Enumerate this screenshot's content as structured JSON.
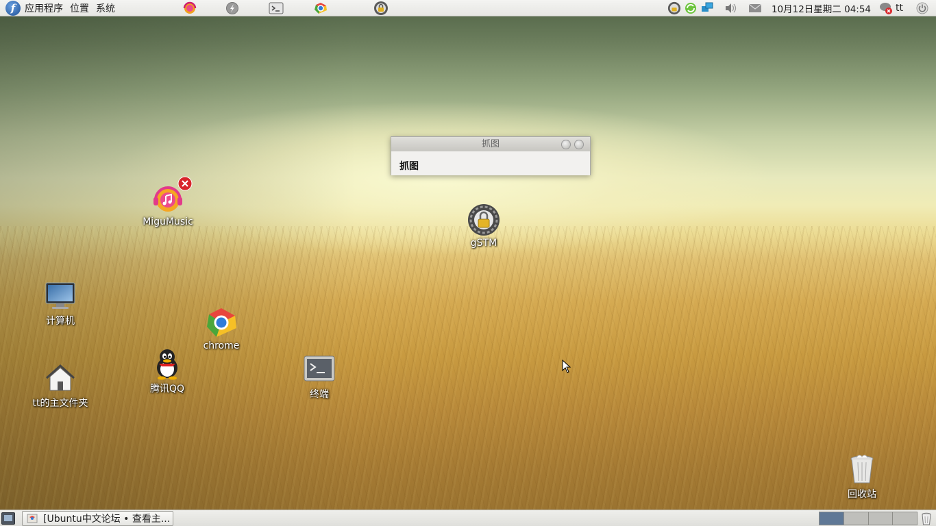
{
  "top_panel": {
    "menus": [
      "应用程序",
      "位置",
      "系统"
    ],
    "clock": "10月12日星期二 04:54",
    "user": "tt",
    "launchers": [
      "migu-music-icon",
      "flash-icon",
      "terminal-icon",
      "chrome-icon",
      "gstm-icon"
    ],
    "tray_icons": [
      "gstm-tray-icon",
      "sync-icon",
      "network-icon",
      "volume-icon",
      "mail-icon",
      "chat-offline-icon"
    ]
  },
  "desktop": {
    "icons": [
      {
        "label": "MiguMusic",
        "icon": "migu-music-icon"
      },
      {
        "label": "gSTM",
        "icon": "gstm-icon"
      },
      {
        "label": "计算机",
        "icon": "computer-icon"
      },
      {
        "label": "chrome",
        "icon": "chrome-icon"
      },
      {
        "label": "tt的主文件夹",
        "icon": "home-folder-icon"
      },
      {
        "label": "腾讯QQ",
        "icon": "qq-icon"
      },
      {
        "label": "终端",
        "icon": "terminal-icon"
      },
      {
        "label": "回收站",
        "icon": "trash-icon"
      }
    ]
  },
  "window": {
    "title": "抓图",
    "body_text": "抓图"
  },
  "bottom_panel": {
    "task_button": "[Ubuntu中文论坛 • 查看主...",
    "workspaces": 4,
    "active_workspace": 1
  },
  "colors": {
    "panel": "#e8e8e5",
    "workspace_active": "#5f7896",
    "sky_green": "#6b7d5c",
    "wheat": "#c89a40"
  }
}
